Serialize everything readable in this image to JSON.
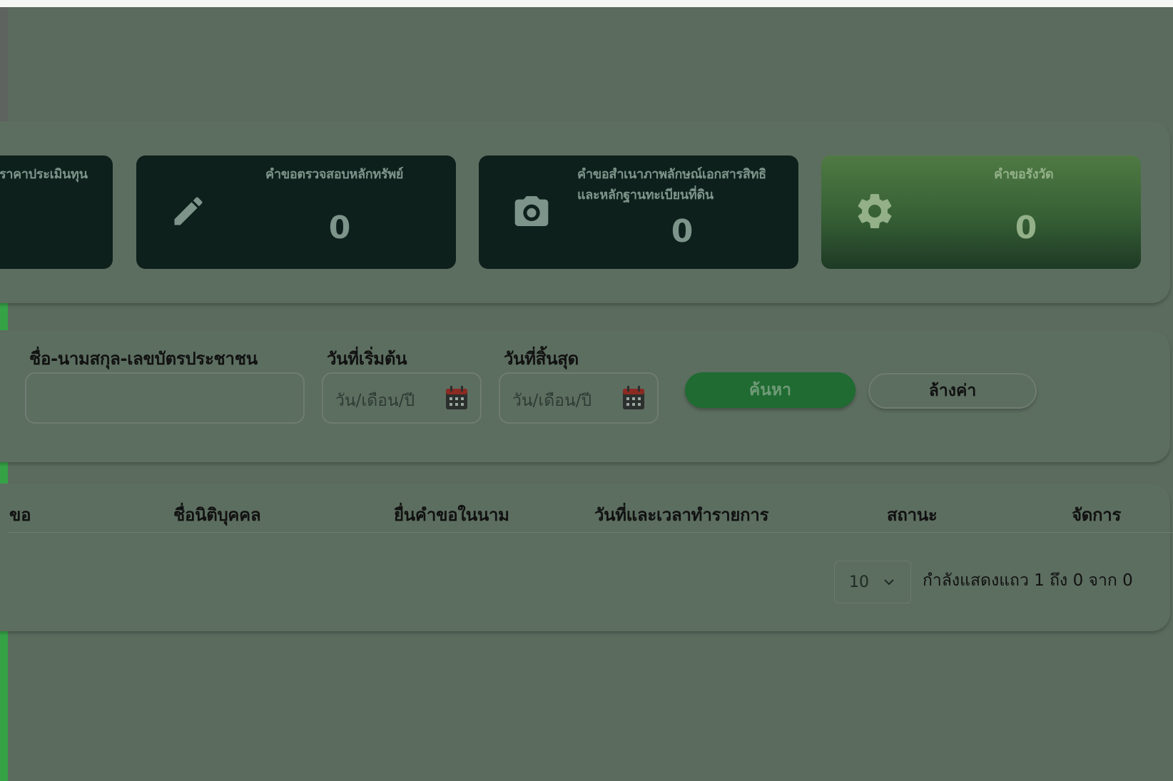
{
  "cards": [
    {
      "title": "ราคาประเมินทุน",
      "count": "",
      "icon": "none",
      "highlight": false
    },
    {
      "title": "คำขอตรวจสอบหลักทรัพย์",
      "count": "0",
      "icon": "pencil-icon",
      "highlight": false
    },
    {
      "title_line1": "คำขอสำเนาภาพลักษณ์เอกสารสิทธิ",
      "title_line2": "และหลักฐานทะเบียนที่ดิน",
      "count": "0",
      "icon": "camera-icon",
      "highlight": false
    },
    {
      "title": "คำขอรังวัด",
      "count": "0",
      "icon": "gear-icon",
      "highlight": true
    }
  ],
  "search": {
    "name_label": "ชื่อ-นามสกุล-เลขบัตรประชาชน",
    "name_value": "",
    "start_label": "วันที่เริ่มต้น",
    "start_placeholder": "วัน/เดือน/ปี",
    "end_label": "วันที่สิ้นสุด",
    "end_placeholder": "วัน/เดือน/ปี",
    "search_button": "ค้นหา",
    "clear_button": "ล้างค่า"
  },
  "table": {
    "columns": [
      "ขอ",
      "ชื่อนิติบุคคล",
      "ยื่นคำขอในนาม",
      "วันที่และเวลาทำรายการ",
      "สถานะ",
      "จัดการ"
    ],
    "rows": []
  },
  "pagination": {
    "page_size": "10",
    "info": "กำลังแสดงแถว 1 ถึง 0 จาก 0"
  },
  "colors": {
    "overlay_background": "#5b6b5e",
    "card_dark": "#0e201b",
    "card_highlight": "#4f7a43",
    "search_button": "#1f6b32",
    "accent_green": "#35a246"
  }
}
